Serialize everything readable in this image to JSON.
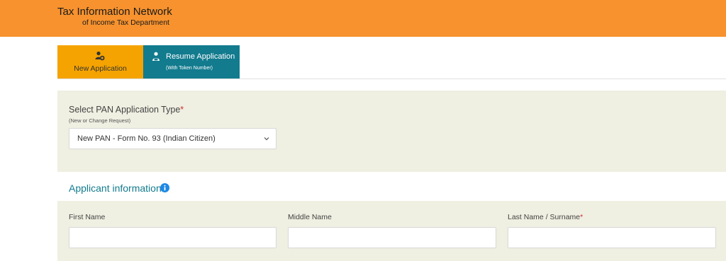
{
  "header": {
    "title": "Tax Information Network",
    "subtitle": "of Income Tax Department",
    "color": "#f7922e"
  },
  "tabs": [
    {
      "label": "New Application",
      "icon": "add-user-icon",
      "color": "#f5a300",
      "active": true
    },
    {
      "label": "Resume Application",
      "sublabel": "(With Token Number)",
      "icon": "user-resume-icon",
      "color": "#127b8e"
    }
  ],
  "pan_type": {
    "label": "Select PAN Application Type",
    "required_mark": "*",
    "hint": "(New or Change Request)",
    "selected": "New PAN - Form No. 93 (Indian Citizen)"
  },
  "applicant": {
    "title": "Applicant information",
    "info_icon": "info-icon",
    "fields": [
      {
        "label": "First Name",
        "required": false,
        "value": ""
      },
      {
        "label": "Middle Name",
        "required": false,
        "value": ""
      },
      {
        "label": "Last Name / Surname",
        "required": true,
        "required_mark": "*",
        "value": ""
      }
    ]
  },
  "colors": {
    "accent": "#127b8e",
    "panel_bg": "#efefe2",
    "required": "#d32f2f"
  }
}
